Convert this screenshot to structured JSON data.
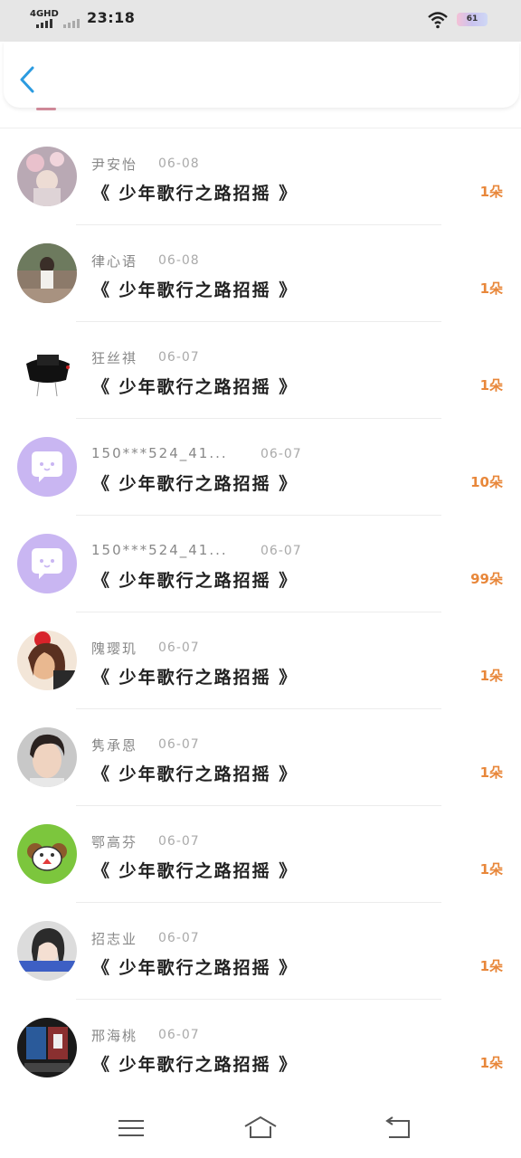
{
  "status_bar": {
    "network": "4GHD",
    "time": "23:18",
    "battery": "61"
  },
  "header": {
    "back_icon": "chevron-left-icon"
  },
  "list": {
    "items": [
      {
        "name": "尹安怡",
        "date": "06-08",
        "title": "《 少年歌行之路招摇 》",
        "count": "1朵",
        "avatar": "photo-avatar"
      },
      {
        "name": "律心语",
        "date": "06-08",
        "title": "《 少年歌行之路招摇 》",
        "count": "1朵",
        "avatar": "photo-avatar"
      },
      {
        "name": "狂丝祺",
        "date": "06-07",
        "title": "《 少年歌行之路招摇 》",
        "count": "1朵",
        "avatar": "photo-avatar"
      },
      {
        "name": "150***524_41...",
        "date": "06-07",
        "title": "《 少年歌行之路招摇 》",
        "count": "10朵",
        "avatar": "default-chat-avatar"
      },
      {
        "name": "150***524_41...",
        "date": "06-07",
        "title": "《 少年歌行之路招摇 》",
        "count": "99朵",
        "avatar": "default-chat-avatar"
      },
      {
        "name": "隗璎玑",
        "date": "06-07",
        "title": "《 少年歌行之路招摇 》",
        "count": "1朵",
        "avatar": "photo-avatar"
      },
      {
        "name": "隽承恩",
        "date": "06-07",
        "title": "《 少年歌行之路招摇 》",
        "count": "1朵",
        "avatar": "photo-avatar"
      },
      {
        "name": "鄂高芬",
        "date": "06-07",
        "title": "《 少年歌行之路招摇 》",
        "count": "1朵",
        "avatar": "cartoon-sheep-avatar"
      },
      {
        "name": "招志业",
        "date": "06-07",
        "title": "《 少年歌行之路招摇 》",
        "count": "1朵",
        "avatar": "photo-avatar"
      },
      {
        "name": "邢海桃",
        "date": "06-07",
        "title": "《 少年歌行之路招摇 》",
        "count": "1朵",
        "avatar": "photo-avatar"
      }
    ]
  },
  "navbar": {
    "menu_icon": "menu-icon",
    "home_icon": "home-icon",
    "back_icon": "return-icon"
  },
  "colors": {
    "accent": "#e8873a",
    "back_arrow": "#2b9be0",
    "default_avatar": "#c9b6f2"
  }
}
